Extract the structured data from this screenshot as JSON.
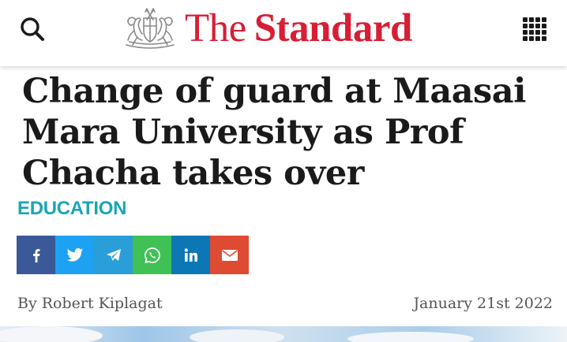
{
  "header": {
    "logo_the": "The",
    "logo_standard": "Standard",
    "search_icon": "search-icon",
    "menu_icon": "grid-menu-icon",
    "brand_color": "#d71e35"
  },
  "article": {
    "title": "Change of guard at Maasai Mara University as Prof Chacha takes over",
    "category": "EDUCATION",
    "category_color": "#1aa5b9",
    "author": "By Robert Kiplagat",
    "date": "January 21st 2022"
  },
  "share_buttons": [
    {
      "icon": "facebook-icon",
      "color": "#3b5998"
    },
    {
      "icon": "twitter-icon",
      "color": "#1da1f2"
    },
    {
      "icon": "telegram-icon",
      "color": "#2a9ed9"
    },
    {
      "icon": "whatsapp-icon",
      "color": "#3fc155"
    },
    {
      "icon": "linkedin-icon",
      "color": "#0b77b5"
    },
    {
      "icon": "email-icon",
      "color": "#df4a32"
    }
  ]
}
